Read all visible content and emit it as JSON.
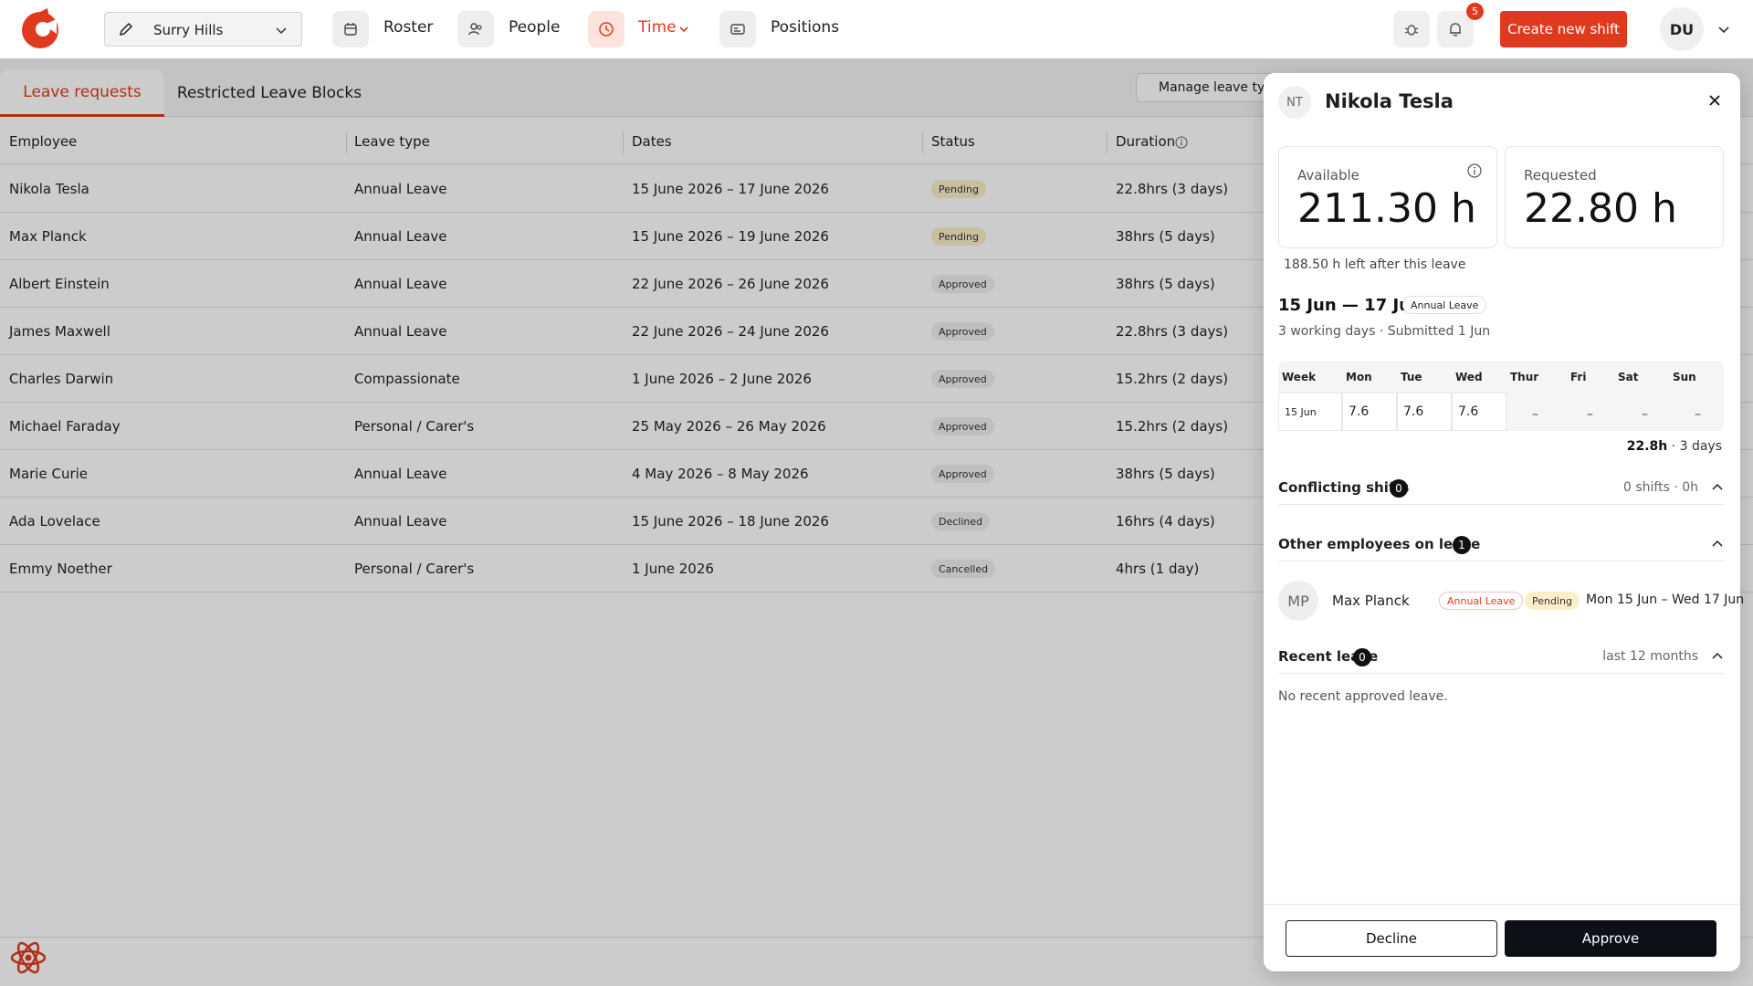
{
  "topbar": {
    "location": "Surry Hills",
    "nav": [
      {
        "label": "Roster",
        "icon": "calendar-icon"
      },
      {
        "label": "People",
        "icon": "people-icon"
      },
      {
        "label": "Time",
        "icon": "clock-icon",
        "active": true
      },
      {
        "label": "Positions",
        "icon": "id-card-icon"
      }
    ],
    "notifications_count": "5",
    "create_label": "Create new shift",
    "user_initials": "DU",
    "accent_color": "#e03a1e"
  },
  "tabs": [
    {
      "label": "Leave requests",
      "active": true
    },
    {
      "label": "Restricted Leave Blocks",
      "active": false
    }
  ],
  "manage_label": "Manage leave types",
  "table": {
    "columns": [
      "Employee",
      "Leave type",
      "Dates",
      "Status",
      "Duration"
    ],
    "rows": [
      {
        "employee": "Nikola Tesla",
        "type": "Annual Leave",
        "dates": "15 June 2026 – 17 June 2026",
        "status": "Pending",
        "duration": "22.8hrs (3 days)"
      },
      {
        "employee": "Max Planck",
        "type": "Annual Leave",
        "dates": "15 June 2026 – 19 June 2026",
        "status": "Pending",
        "duration": "38hrs (5 days)"
      },
      {
        "employee": "Albert Einstein",
        "type": "Annual Leave",
        "dates": "22 June 2026 – 26 June 2026",
        "status": "Approved",
        "duration": "38hrs (5 days)"
      },
      {
        "employee": "James Maxwell",
        "type": "Annual Leave",
        "dates": "22 June 2026 – 24 June 2026",
        "status": "Approved",
        "duration": "22.8hrs (3 days)"
      },
      {
        "employee": "Charles Darwin",
        "type": "Compassionate",
        "dates": "1 June 2026 – 2 June 2026",
        "status": "Approved",
        "duration": "15.2hrs (2 days)"
      },
      {
        "employee": "Michael Faraday",
        "type": "Personal / Carer's",
        "dates": "25 May 2026 – 26 May 2026",
        "status": "Approved",
        "duration": "15.2hrs (2 days)"
      },
      {
        "employee": "Marie Curie",
        "type": "Annual Leave",
        "dates": "4 May 2026 – 8 May 2026",
        "status": "Approved",
        "duration": "38hrs (5 days)"
      },
      {
        "employee": "Ada Lovelace",
        "type": "Annual Leave",
        "dates": "15 June 2026 – 18 June 2026",
        "status": "Declined",
        "duration": "16hrs (4 days)"
      },
      {
        "employee": "Emmy Noether",
        "type": "Personal / Carer's",
        "dates": "1 June 2026",
        "status": "Cancelled",
        "duration": "4hrs (1 day)"
      }
    ]
  },
  "panel": {
    "initials": "NT",
    "name": "Nikola Tesla",
    "available_label": "Available",
    "available_value": "211.30 h",
    "requested_label": "Requested",
    "requested_value": "22.80 h",
    "left_after": "188.50 h left after this leave",
    "range": "15 Jun — 17 Jun",
    "leave_type": "Annual Leave",
    "sub": "3 working days · Submitted 1 Jun",
    "grid": {
      "headers": [
        "Week",
        "Mon",
        "Tue",
        "Wed",
        "Thur",
        "Fri",
        "Sat",
        "Sun"
      ],
      "week": "15 Jun",
      "values": [
        "7.6",
        "7.6",
        "7.6",
        "–",
        "–",
        "–",
        "–"
      ]
    },
    "total_hours": "22.8h",
    "total_days": " · 3 days",
    "conflicting": {
      "title": "Conflicting shifts",
      "count": "0",
      "meta": "0 shifts · 0h"
    },
    "others": {
      "title": "Other employees on leave",
      "count": "1"
    },
    "other_employee": {
      "initials": "MP",
      "name": "Max Planck",
      "type": "Annual Leave",
      "status": "Pending",
      "range": "Mon 15 Jun – Wed 17 Jun"
    },
    "recent": {
      "title": "Recent leave",
      "count": "0",
      "meta": "last 12 months"
    },
    "no_recent": "No recent approved leave.",
    "decline_label": "Decline",
    "approve_label": "Approve"
  }
}
